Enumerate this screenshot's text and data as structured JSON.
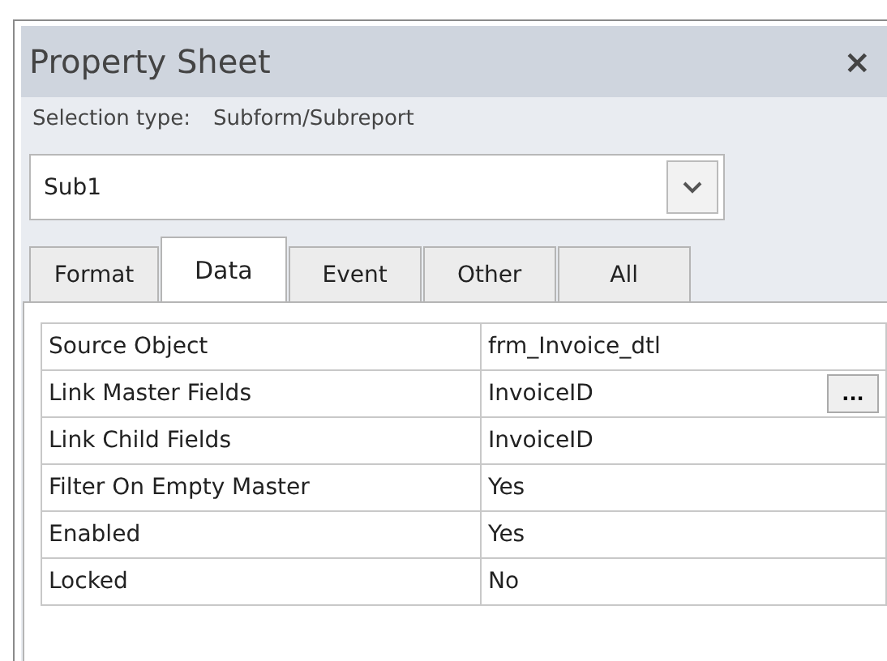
{
  "window": {
    "title": "Property Sheet",
    "close": "×"
  },
  "selection_type": {
    "label": "Selection type:",
    "value": "Subform/Subreport"
  },
  "object_select": {
    "value": "Sub1"
  },
  "tabs": [
    {
      "label": "Format",
      "selected": false
    },
    {
      "label": "Data",
      "selected": true
    },
    {
      "label": "Event",
      "selected": false
    },
    {
      "label": "Other",
      "selected": false
    },
    {
      "label": "All",
      "selected": false
    }
  ],
  "properties": [
    {
      "name": "Source Object",
      "value": "frm_Invoice_dtl"
    },
    {
      "name": "Link Master Fields",
      "value": "InvoiceID",
      "builder": "..."
    },
    {
      "name": "Link Child Fields",
      "value": "InvoiceID"
    },
    {
      "name": "Filter On Empty Master",
      "value": "Yes"
    },
    {
      "name": "Enabled",
      "value": "Yes"
    },
    {
      "name": "Locked",
      "value": "No"
    }
  ]
}
